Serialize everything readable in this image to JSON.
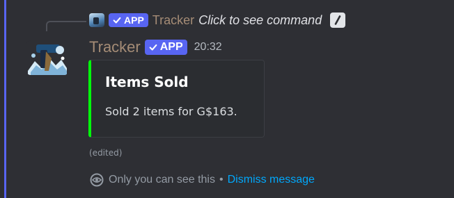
{
  "reply": {
    "app_badge": "APP",
    "name": "Tracker",
    "command_hint": "Click to see command",
    "slash_glyph": "/"
  },
  "message": {
    "username": "Tracker",
    "app_badge": "APP",
    "timestamp": "20:32",
    "edited": "(edited)"
  },
  "embed": {
    "title": "Items Sold",
    "description": "Sold 2 items for G$163.",
    "accent_color": "#00ff0a"
  },
  "ephemeral": {
    "notice": "Only you can see this",
    "separator": "•",
    "dismiss_label": "Dismiss message"
  },
  "colors": {
    "background": "#2e2f34",
    "highlight_bar": "#5865f2",
    "app_badge": "#5865f2",
    "username": "#a58c76",
    "link": "#00a8fc"
  },
  "icons": {
    "app_badge": "checkmark-icon",
    "slash_command": "slash-command-icon",
    "ephemeral": "eye-icon"
  }
}
